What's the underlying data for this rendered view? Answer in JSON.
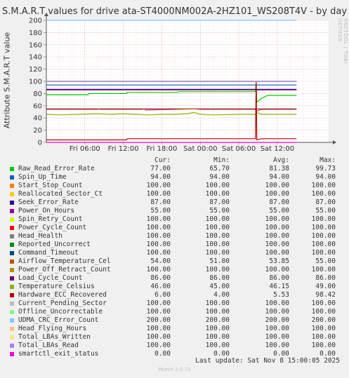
{
  "chart_data": {
    "type": "line",
    "title": "S.M.A.R.T values for drive ata-ST4000NM002A-2HZ101_WS208T4V - by day",
    "ylabel": "Attribute S.M.A.R.T value",
    "ylim": [
      0,
      200
    ],
    "yticks": [
      0,
      20,
      40,
      60,
      80,
      100,
      120,
      140,
      160,
      180,
      200
    ],
    "x_tick_labels": [
      "Fri 06:00",
      "Fri 12:00",
      "Fri 18:00",
      "Sat 00:00",
      "Sat 06:00",
      "Sat 12:00"
    ],
    "x_hours_range": [
      -6,
      38
    ],
    "x_tick_hours": [
      0,
      6,
      12,
      18,
      24,
      30
    ],
    "grid": true,
    "series": [
      {
        "name": "Raw_Read_Error_Rate",
        "color": "#00cc00",
        "cur": "77.00",
        "min": "65.70",
        "avg": "81.38",
        "max": "99.73",
        "points": [
          [
            -6,
            78
          ],
          [
            0.5,
            78
          ],
          [
            0.6,
            80
          ],
          [
            6.5,
            80
          ],
          [
            6.6,
            82
          ],
          [
            14.5,
            82
          ],
          [
            14.6,
            83
          ],
          [
            26.6,
            83
          ],
          [
            26.7,
            99.73
          ],
          [
            26.8,
            65.7
          ],
          [
            27.5,
            72
          ],
          [
            28.5,
            77
          ],
          [
            33,
            77
          ]
        ]
      },
      {
        "name": "Spin_Up_Time",
        "color": "#0066b3",
        "cur": "94.00",
        "min": "94.00",
        "avg": "94.00",
        "max": "94.00",
        "points": [
          [
            -6,
            94
          ],
          [
            33,
            94
          ]
        ]
      },
      {
        "name": "Start_Stop_Count",
        "color": "#ff8000",
        "cur": "100.00",
        "min": "100.00",
        "avg": "100.00",
        "max": "100.00",
        "points": [
          [
            -6,
            100
          ],
          [
            33,
            100
          ]
        ]
      },
      {
        "name": "Reallocated_Sector_Ct",
        "color": "#ffcc00",
        "cur": "100.00",
        "min": "100.00",
        "avg": "100.00",
        "max": "100.00",
        "points": [
          [
            -6,
            100
          ],
          [
            33,
            100
          ]
        ]
      },
      {
        "name": "Seek_Error_Rate",
        "color": "#330099",
        "cur": "87.00",
        "min": "87.00",
        "avg": "87.00",
        "max": "87.00",
        "points": [
          [
            -6,
            87
          ],
          [
            33,
            87
          ]
        ]
      },
      {
        "name": "Power_On_Hours",
        "color": "#990099",
        "cur": "55.00",
        "min": "55.00",
        "avg": "55.00",
        "max": "55.00",
        "points": [
          [
            -6,
            55
          ],
          [
            33,
            55
          ]
        ]
      },
      {
        "name": "Spin_Retry_Count",
        "color": "#ccff00",
        "cur": "100.00",
        "min": "100.00",
        "avg": "100.00",
        "max": "100.00",
        "points": [
          [
            -6,
            100
          ],
          [
            33,
            100
          ]
        ]
      },
      {
        "name": "Power_Cycle_Count",
        "color": "#ff0000",
        "cur": "100.00",
        "min": "100.00",
        "avg": "100.00",
        "max": "100.00",
        "points": [
          [
            -6,
            100
          ],
          [
            33,
            100
          ]
        ]
      },
      {
        "name": "Head_Health",
        "color": "#808080",
        "cur": "100.00",
        "min": "100.00",
        "avg": "100.00",
        "max": "100.00",
        "points": [
          [
            -6,
            100
          ],
          [
            33,
            100
          ]
        ]
      },
      {
        "name": "Reported_Uncorrect",
        "color": "#008f00",
        "cur": "100.00",
        "min": "100.00",
        "avg": "100.00",
        "max": "100.00",
        "points": [
          [
            -6,
            100
          ],
          [
            33,
            100
          ]
        ]
      },
      {
        "name": "Command_Timeout",
        "color": "#00487d",
        "cur": "100.00",
        "min": "100.00",
        "avg": "100.00",
        "max": "100.00",
        "points": [
          [
            -6,
            100
          ],
          [
            33,
            100
          ]
        ]
      },
      {
        "name": "Airflow_Temperature_Cel",
        "color": "#b35a00",
        "cur": "54.00",
        "min": "51.00",
        "avg": "53.85",
        "max": "55.00",
        "points": [
          [
            -6,
            54
          ],
          [
            2,
            54
          ],
          [
            2.2,
            55
          ],
          [
            2.4,
            54
          ],
          [
            9,
            54
          ],
          [
            9.2,
            55
          ],
          [
            9.5,
            53
          ],
          [
            14,
            54
          ],
          [
            17,
            55
          ],
          [
            18,
            54
          ],
          [
            22,
            54
          ],
          [
            26.6,
            54
          ],
          [
            26.7,
            51
          ],
          [
            27.5,
            54
          ],
          [
            33,
            54
          ]
        ]
      },
      {
        "name": "Power_Off_Retract_Count",
        "color": "#b38f00",
        "cur": "100.00",
        "min": "100.00",
        "avg": "100.00",
        "max": "100.00",
        "points": [
          [
            -6,
            100
          ],
          [
            33,
            100
          ]
        ]
      },
      {
        "name": "Load_Cycle_Count",
        "color": "#6b006b",
        "cur": "86.00",
        "min": "86.00",
        "avg": "86.00",
        "max": "86.00",
        "points": [
          [
            -6,
            86
          ],
          [
            33,
            86
          ]
        ]
      },
      {
        "name": "Temperature_Celsius",
        "color": "#8fb300",
        "cur": "46.00",
        "min": "45.00",
        "avg": "46.15",
        "max": "49.00",
        "points": [
          [
            -6,
            46
          ],
          [
            -4,
            45
          ],
          [
            -1,
            46
          ],
          [
            2,
            47
          ],
          [
            4,
            46
          ],
          [
            6,
            47
          ],
          [
            8,
            46
          ],
          [
            10,
            45
          ],
          [
            12,
            46
          ],
          [
            14,
            46
          ],
          [
            16,
            47
          ],
          [
            17,
            49
          ],
          [
            18,
            46
          ],
          [
            20,
            45
          ],
          [
            24,
            46
          ],
          [
            26.6,
            46
          ],
          [
            26.7,
            49
          ],
          [
            27.5,
            46
          ],
          [
            30,
            46
          ],
          [
            33,
            46
          ]
        ]
      },
      {
        "name": "Hardware_ECC_Recovered",
        "color": "#b30000",
        "cur": "6.00",
        "min": "4.00",
        "avg": "5.53",
        "max": "98.42",
        "points": [
          [
            -6,
            4
          ],
          [
            6.5,
            4
          ],
          [
            6.6,
            6
          ],
          [
            26.6,
            6
          ],
          [
            26.7,
            98.42
          ],
          [
            26.8,
            4
          ],
          [
            27.5,
            6
          ],
          [
            33,
            6
          ]
        ]
      },
      {
        "name": "Current_Pending_Sector",
        "color": "#bebebe",
        "cur": "100.00",
        "min": "100.00",
        "avg": "100.00",
        "max": "100.00",
        "points": [
          [
            -6,
            100
          ],
          [
            33,
            100
          ]
        ]
      },
      {
        "name": "Offline_Uncorrectable",
        "color": "#80ff80",
        "cur": "100.00",
        "min": "100.00",
        "avg": "100.00",
        "max": "100.00",
        "points": [
          [
            -6,
            100
          ],
          [
            33,
            100
          ]
        ]
      },
      {
        "name": "UDMA_CRC_Error_Count",
        "color": "#80c9ff",
        "cur": "200.00",
        "min": "200.00",
        "avg": "200.00",
        "max": "200.00",
        "points": [
          [
            -6,
            200
          ],
          [
            33,
            200
          ]
        ]
      },
      {
        "name": "Head_Flying_Hours",
        "color": "#ffc080",
        "cur": "100.00",
        "min": "100.00",
        "avg": "100.00",
        "max": "100.00",
        "points": [
          [
            -6,
            100
          ],
          [
            33,
            100
          ]
        ]
      },
      {
        "name": "Total_LBAs_Written",
        "color": "#ffe680",
        "cur": "100.00",
        "min": "100.00",
        "avg": "100.00",
        "max": "100.00",
        "points": [
          [
            -6,
            100
          ],
          [
            33,
            100
          ]
        ]
      },
      {
        "name": "Total_LBAs_Read",
        "color": "#aa80ff",
        "cur": "100.00",
        "min": "100.00",
        "avg": "100.00",
        "max": "100.00",
        "points": [
          [
            -6,
            100
          ],
          [
            33,
            100
          ]
        ]
      },
      {
        "name": "smartctl_exit_status",
        "color": "#ee00cc",
        "cur": "0.00",
        "min": "0.00",
        "avg": "0.00",
        "max": "0.00",
        "points": [
          [
            -6,
            0
          ],
          [
            33,
            0
          ]
        ]
      }
    ]
  },
  "legend_headers": {
    "cur": "Cur:",
    "min": "Min:",
    "avg": "Avg:",
    "max": "Max:"
  },
  "footer": "Last update: Sat Nov  8 15:00:05 2025",
  "version": "Munin 2.0.73",
  "side_text": "RRDTOOL / TOBI OETIKER"
}
